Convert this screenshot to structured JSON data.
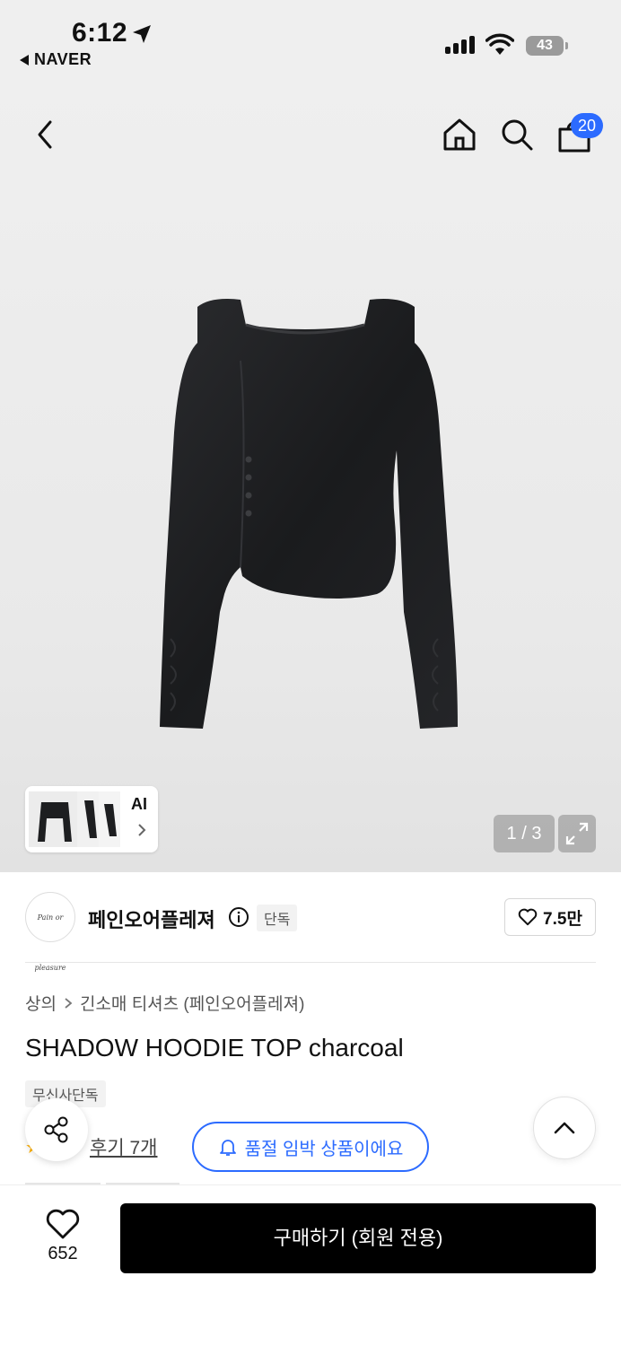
{
  "status_bar": {
    "time": "6:12",
    "back_app": "NAVER",
    "battery": "43"
  },
  "header": {
    "cart_count": "20",
    "icons": [
      "back-chevron-icon",
      "home-icon",
      "search-icon",
      "cart-icon"
    ]
  },
  "gallery": {
    "thumb_label": "AI",
    "pager": "1 / 3"
  },
  "brand": {
    "logo_text": "Pain or pleasure",
    "name": "페인오어플레져",
    "tag": "단독",
    "likes": "7.5만"
  },
  "product": {
    "breadcrumb": [
      "상의",
      "긴소매 티셔츠 (페인오어플레져)"
    ],
    "title": "SHADOW HOODIE TOP charcoal",
    "store_tag": "무신사단독",
    "reviews": "후기 7개",
    "stock_notice": "품절 임박 상품이에요"
  },
  "bottom_bar": {
    "wish_count": "652",
    "buy_label": "구매하기 (회원 전용)"
  },
  "colors": {
    "accent": "#2c6bff",
    "buy_button": "#000000",
    "badge": "#2c6bff"
  }
}
